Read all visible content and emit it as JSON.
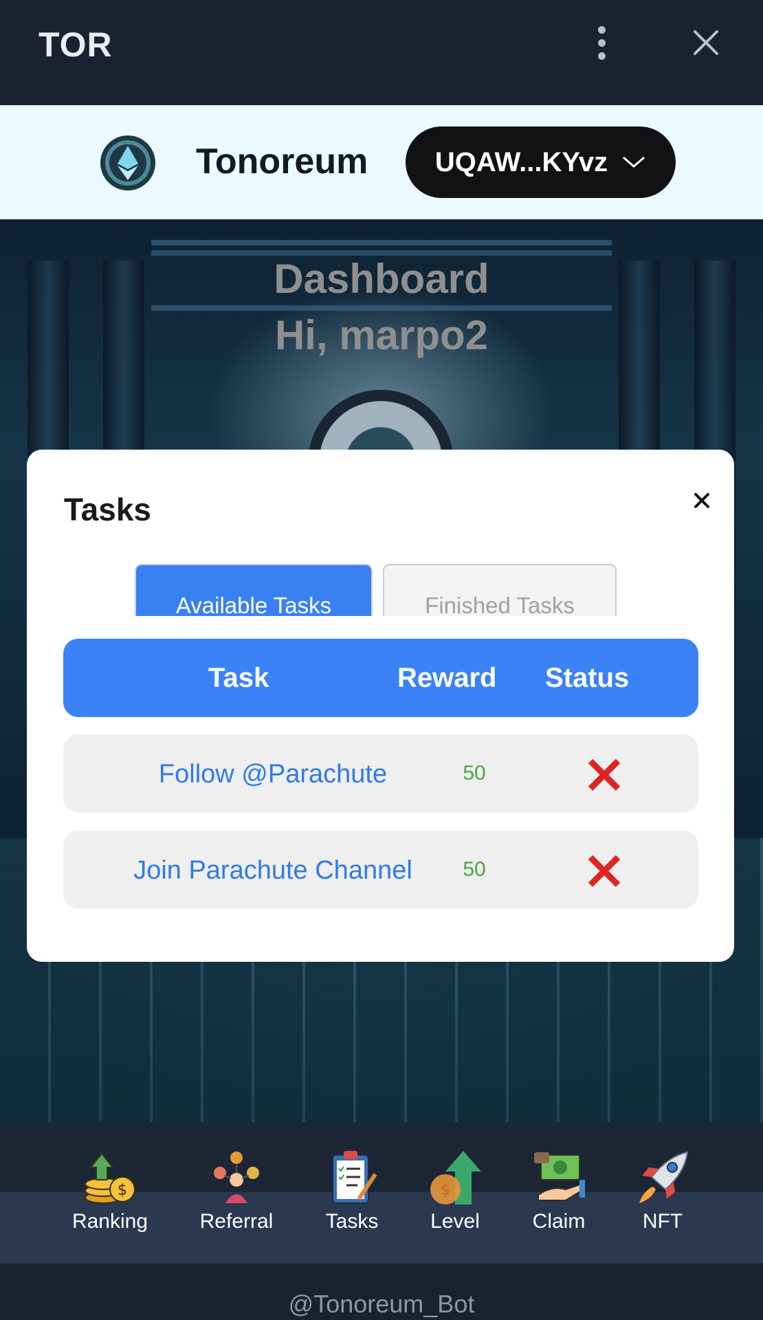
{
  "topbar": {
    "title": "TOR"
  },
  "header": {
    "brand": "Tonoreum",
    "wallet": "UQAW...KYvz"
  },
  "dashboard": {
    "title": "Dashboard",
    "greeting": "Hi, marpo2"
  },
  "modal": {
    "title": "Tasks",
    "tabs": {
      "available": "Available Tasks",
      "finished": "Finished Tasks"
    },
    "columns": {
      "task": "Task",
      "reward": "Reward",
      "status": "Status"
    },
    "rows": [
      {
        "task": "Follow @Parachute",
        "reward": "50",
        "status": "not-completed"
      },
      {
        "task": "Join Parachute Channel",
        "reward": "50",
        "status": "not-completed"
      }
    ]
  },
  "nav": {
    "items": [
      {
        "label": "Ranking",
        "icon": "ranking-coins-icon"
      },
      {
        "label": "Referral",
        "icon": "referral-people-icon"
      },
      {
        "label": "Tasks",
        "icon": "clipboard-tasks-icon"
      },
      {
        "label": "Level",
        "icon": "level-up-arrow-icon"
      },
      {
        "label": "Claim",
        "icon": "claim-money-hand-icon"
      },
      {
        "label": "NFT",
        "icon": "rocket-icon"
      }
    ]
  },
  "footer": {
    "bot": "@Tonoreum_Bot"
  },
  "colors": {
    "accent": "#3b82f6",
    "reward": "#47a63d",
    "status_fail": "#e02424"
  }
}
